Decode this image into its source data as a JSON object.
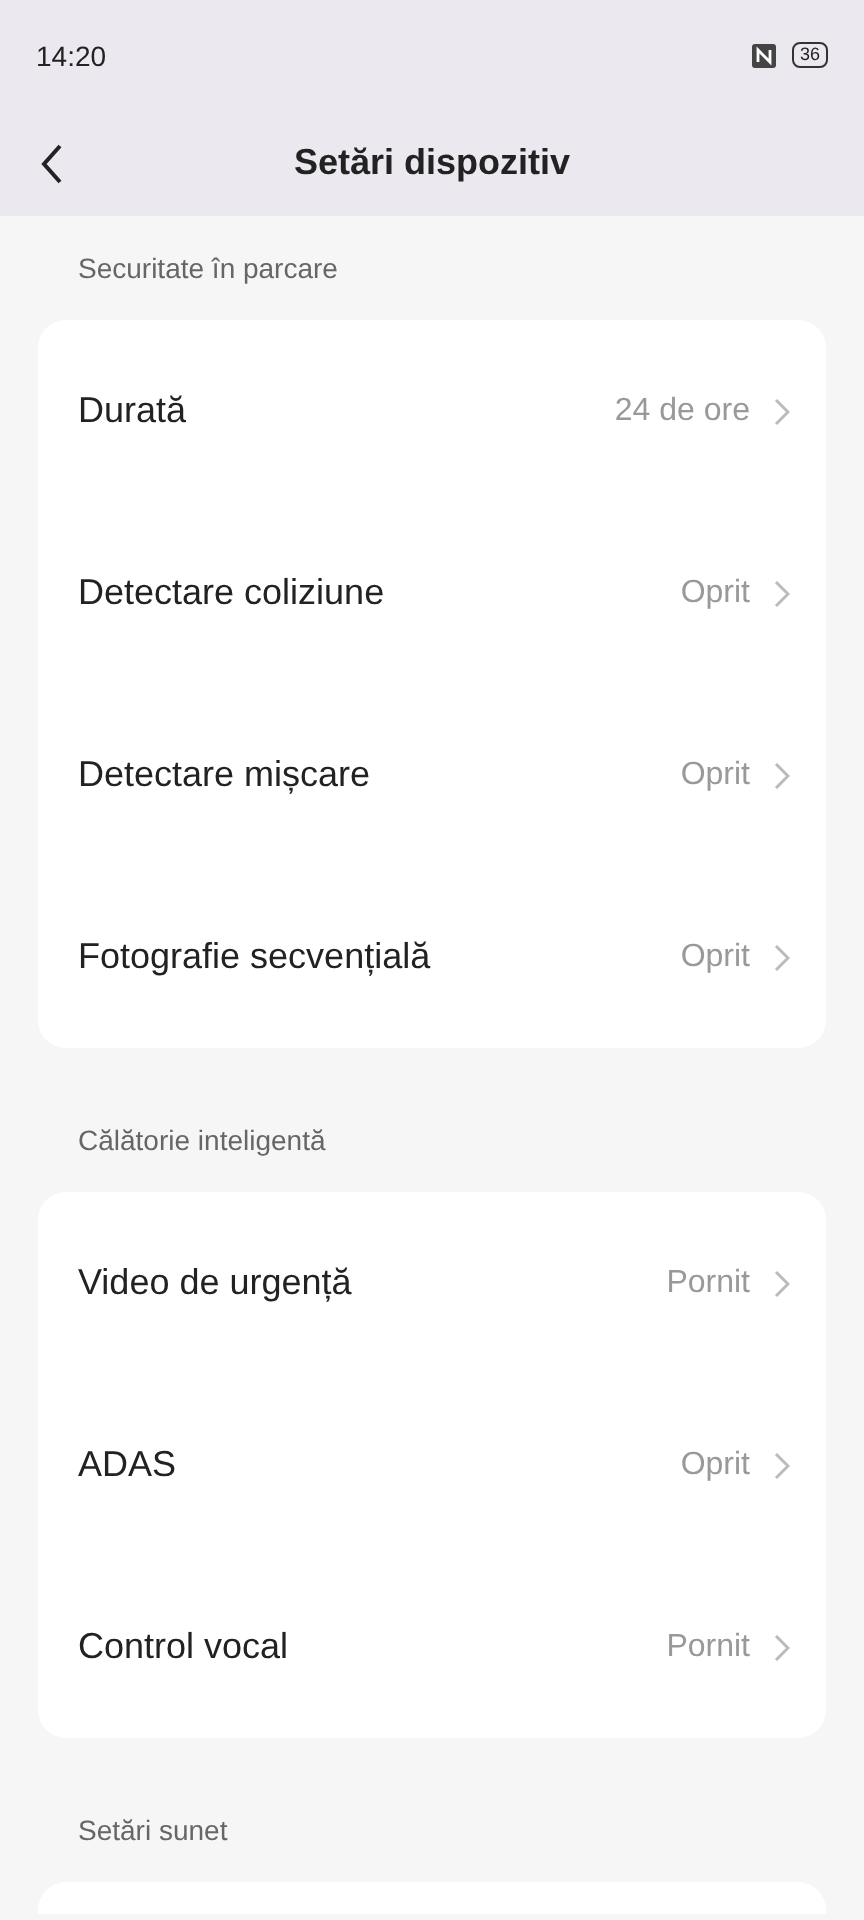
{
  "status_bar": {
    "time": "14:20",
    "battery": "36"
  },
  "header": {
    "title": "Setări dispozitiv"
  },
  "sections": [
    {
      "title": "Securitate în parcare",
      "items": [
        {
          "label": "Durată",
          "value": "24 de ore"
        },
        {
          "label": "Detectare coliziune",
          "value": "Oprit"
        },
        {
          "label": "Detectare mișcare",
          "value": "Oprit"
        },
        {
          "label": "Fotografie secvențială",
          "value": "Oprit"
        }
      ]
    },
    {
      "title": "Călătorie inteligentă",
      "items": [
        {
          "label": "Video de urgență",
          "value": "Pornit"
        },
        {
          "label": "ADAS",
          "value": "Oprit"
        },
        {
          "label": "Control vocal",
          "value": "Pornit"
        }
      ]
    },
    {
      "title": "Setări sunet"
    }
  ]
}
